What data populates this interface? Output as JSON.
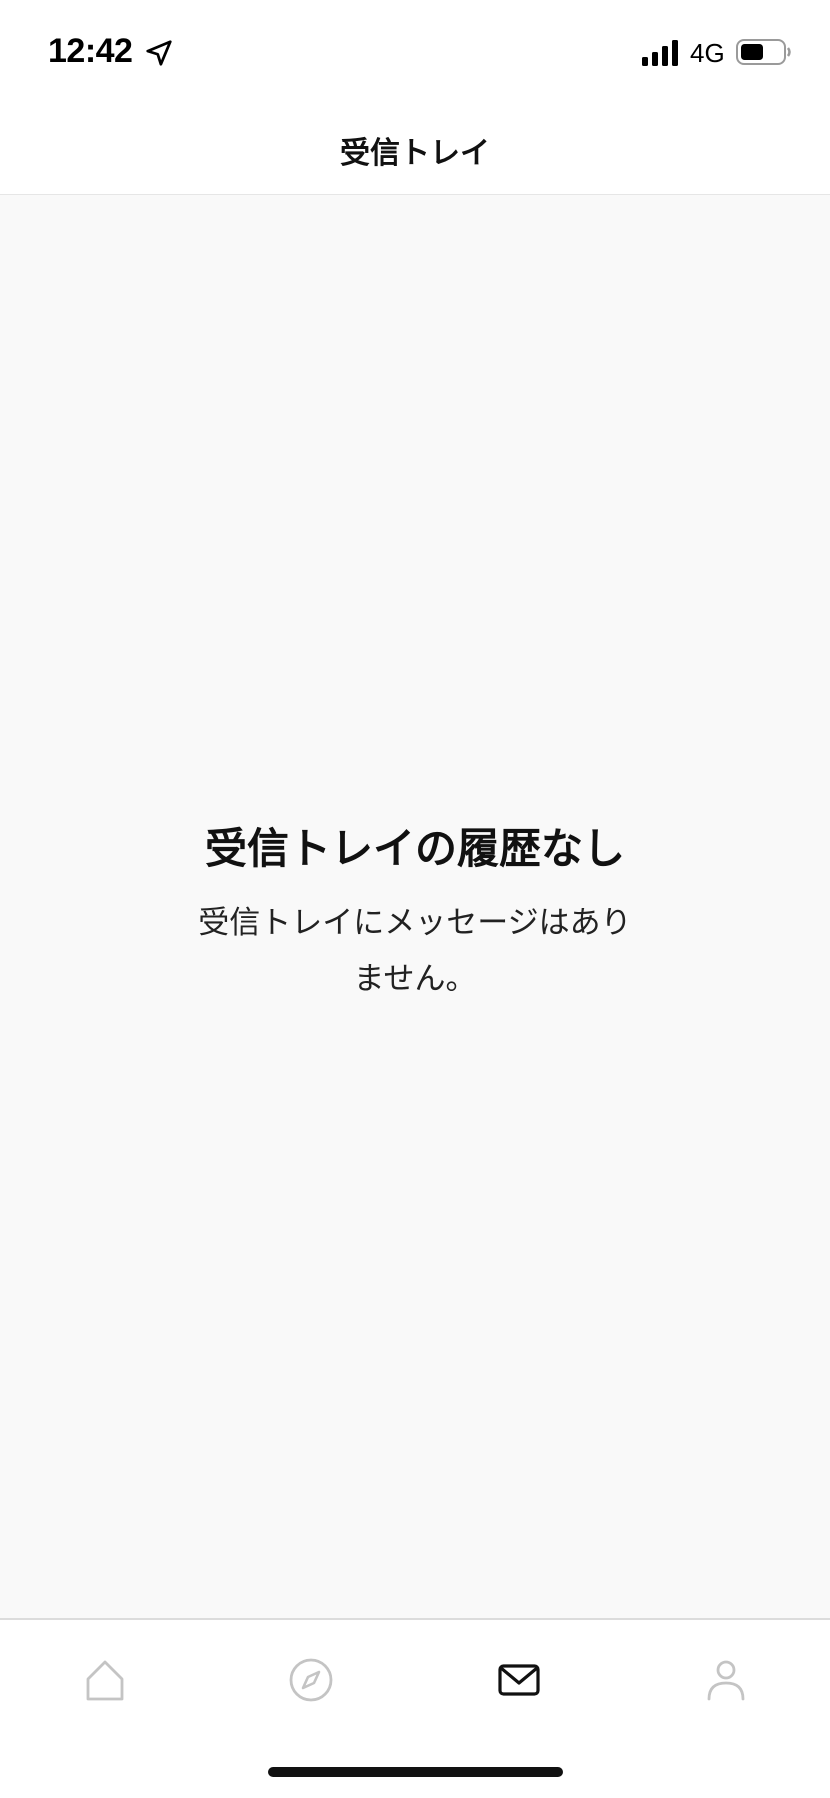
{
  "status_bar": {
    "time": "12:42",
    "network": "4G",
    "icons": [
      "location-arrow-icon",
      "cellular-signal-icon",
      "battery-icon"
    ]
  },
  "header": {
    "title": "受信トレイ"
  },
  "empty_state": {
    "title": "受信トレイの履歴なし",
    "message_line1": "受信トレイにメッセージはあり",
    "message_line2": "ません。"
  },
  "tab_bar": {
    "tabs": [
      {
        "icon": "home-icon",
        "active": false
      },
      {
        "icon": "compass-icon",
        "active": false
      },
      {
        "icon": "envelope-icon",
        "active": true
      },
      {
        "icon": "person-icon",
        "active": false
      }
    ]
  },
  "colors": {
    "background": "#f9f9f9",
    "surface": "#ffffff",
    "active_icon": "#111111",
    "inactive_icon": "#c4c4c4",
    "text_primary": "#111111"
  }
}
